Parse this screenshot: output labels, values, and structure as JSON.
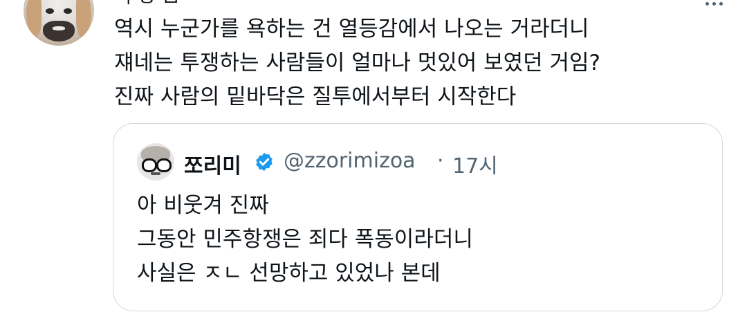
{
  "tweet": {
    "header_fragment": "ᅵ ᄒ ᄆ",
    "text_lines": [
      "역시 누군가를 욕하는 건 열등감에서 나오는 거라더니",
      "쟤네는 투쟁하는 사람들이 얼마나 멋있어 보였던 거임?",
      "진짜 사람의 밑바닥은 질투에서부터 시작한다"
    ],
    "more_icon": "more-horizontal-icon"
  },
  "quote": {
    "name": "쪼리미",
    "verified_icon": "verified-badge-icon",
    "handle": "@zzorimizoa",
    "separator": "·",
    "time": "17시",
    "text_lines": [
      "아 비웃겨 진짜",
      "그동안 민주항쟁은 죄다 폭동이라더니",
      "사실은 ㅈㄴ 선망하고 있었나 본데"
    ]
  },
  "colors": {
    "text": "#0f1419",
    "secondary": "#536471",
    "border": "#cfd9de",
    "verified": "#1d9bf0"
  }
}
